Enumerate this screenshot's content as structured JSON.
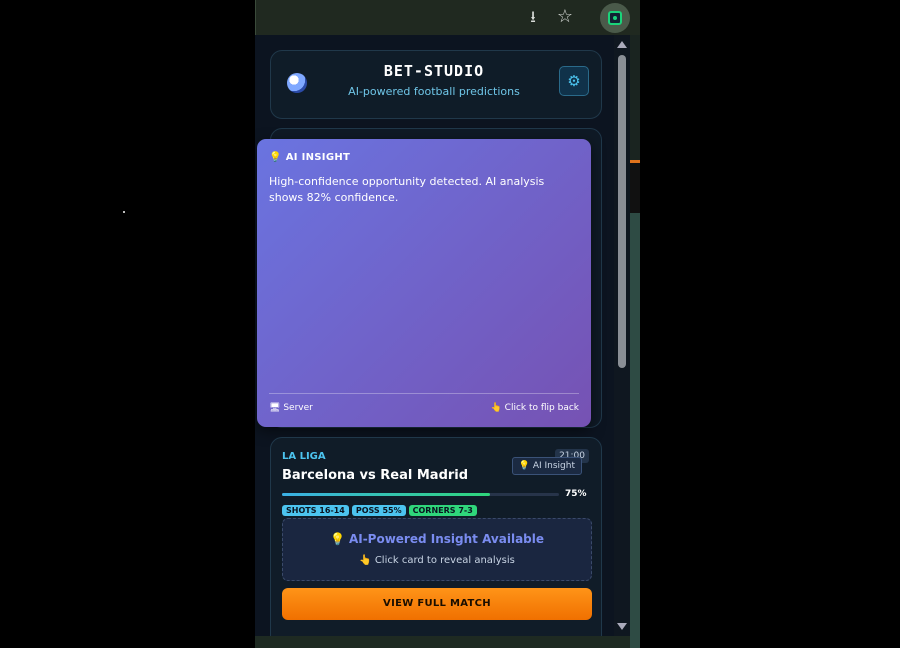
{
  "browser": {
    "install_icon": "install-app-icon",
    "star_icon": "bookmark-star-icon",
    "extension_icon": "bet-studio-extension-icon"
  },
  "header": {
    "brand": "BET-STUDIO",
    "tagline": "AI-powered football predictions",
    "logo_icon": "football-icon",
    "settings_icon": "gear-icon"
  },
  "insight": {
    "title": "AI INSIGHT",
    "text": "High-confidence opportunity detected. AI analysis shows 82% confidence.",
    "source": "Server",
    "flip_hint": "Click to flip back"
  },
  "match": {
    "league": "LA LIGA",
    "time": "21:00",
    "ai_badge": "AI Insight",
    "title": "Barcelona vs Real Madrid",
    "confidence_label": "75%",
    "confidence": 0.75,
    "chips": {
      "shots": "SHOTS 16-14",
      "poss": "POSS 55%",
      "corners": "CORNERS 7-3"
    },
    "cta_title": "AI-Powered Insight Available",
    "cta_sub": "Click card to reveal analysis",
    "button": "VIEW FULL MATCH"
  },
  "colors": {
    "accent": "#4cc4ef",
    "brand_orange": "#ff8a00",
    "insight_gradient_start": "#6a74e0",
    "insight_gradient_end": "#7652b3",
    "success": "#2fd67b"
  }
}
